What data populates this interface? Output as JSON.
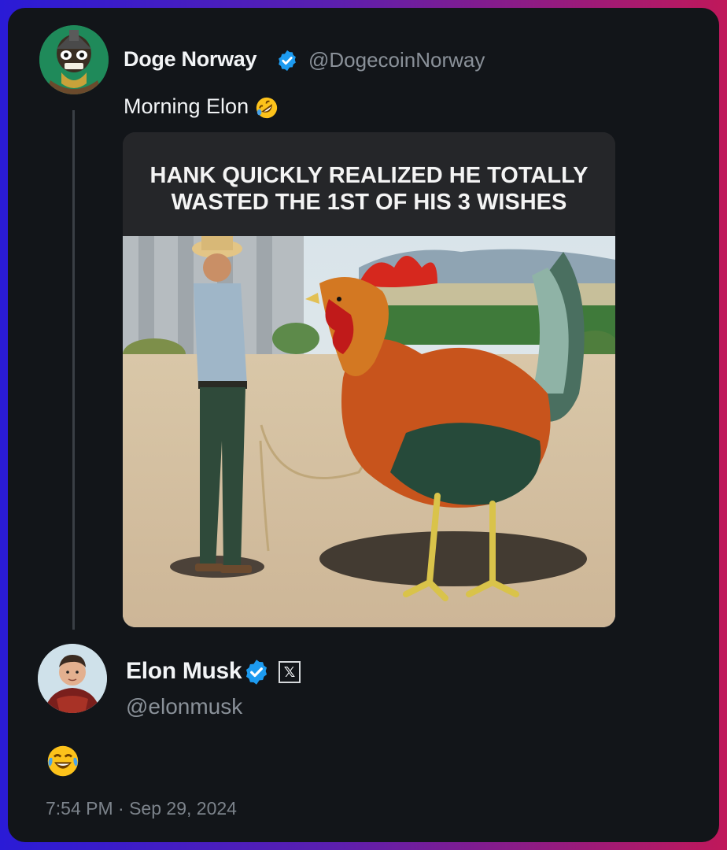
{
  "quoted_tweet": {
    "author_name": "Doge Norway",
    "author_handle": "@DogecoinNorway",
    "text": "Morning Elon",
    "text_emoji": "rolling-on-floor-laughing",
    "image_caption_line1": "HANK QUICKLY REALIZED HE TOTALLY",
    "image_caption_line2": "WASTED THE 1ST OF HIS  3 WISHES"
  },
  "reply_tweet": {
    "author_name": "Elon Musk",
    "author_handle": "@elonmusk",
    "text_emoji": "face-with-tears-of-joy",
    "timestamp": "7:54 PM · Sep 29, 2024"
  },
  "icons": {
    "verified": "verified-badge-icon",
    "affiliate": "x-logo-icon"
  },
  "colors": {
    "card_background": "#121519",
    "verified_blue": "#1d9bf0",
    "secondary_text": "#8a9199"
  }
}
